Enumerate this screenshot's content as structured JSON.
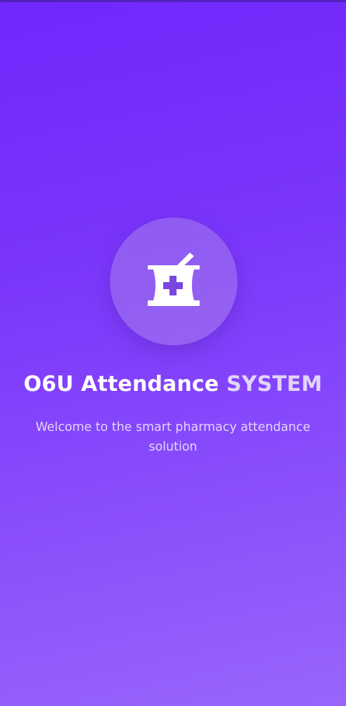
{
  "splash": {
    "logo_icon": "pharmacy-mortar-cross-icon",
    "title_main": "O6U Attendance ",
    "title_accent": "SYSTEM",
    "subtitle": "Welcome to the smart pharmacy attendance solution"
  },
  "colors": {
    "gradient_start": "#7127fd",
    "gradient_end": "#9865fc",
    "title": "#ffffff",
    "title_accent": "#e1d4fa",
    "icon": "#ffffff",
    "icon_cross": "#7b45e0"
  }
}
